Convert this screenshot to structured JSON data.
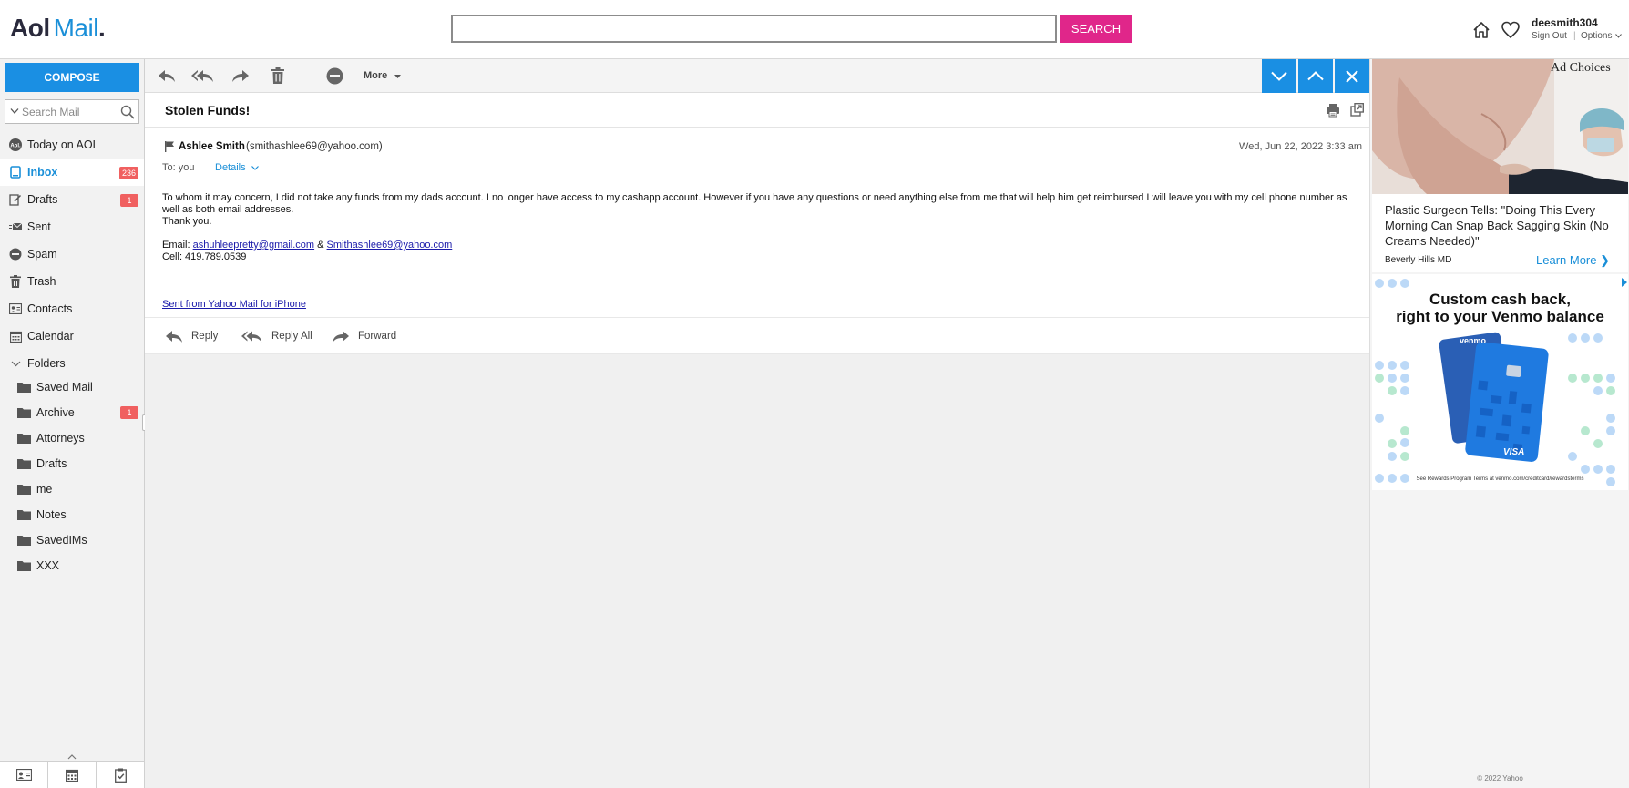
{
  "header": {
    "logo_aol": "Aol",
    "logo_mail": "Mail",
    "logo_dot": ".",
    "search_value": "",
    "search_button": "SEARCH",
    "username": "deesmith304",
    "sign_out": "Sign Out",
    "separator": "|",
    "options": "Options"
  },
  "sidebar": {
    "compose": "COMPOSE",
    "search_placeholder": "Search Mail",
    "nav": [
      {
        "label": "Today on AOL",
        "icon": "aol-icon"
      },
      {
        "label": "Inbox",
        "icon": "inbox-icon",
        "badge": "236",
        "active": true
      },
      {
        "label": "Drafts",
        "icon": "drafts-icon",
        "badge": "1"
      },
      {
        "label": "Sent",
        "icon": "sent-icon"
      },
      {
        "label": "Spam",
        "icon": "spam-icon"
      },
      {
        "label": "Trash",
        "icon": "trash-icon"
      },
      {
        "label": "Contacts",
        "icon": "contacts-icon"
      },
      {
        "label": "Calendar",
        "icon": "calendar-icon"
      },
      {
        "label": "Folders",
        "icon": "chevron-down-icon"
      }
    ],
    "folders": [
      {
        "label": "Saved Mail"
      },
      {
        "label": "Archive",
        "badge": "1"
      },
      {
        "label": "Attorneys"
      },
      {
        "label": "Drafts"
      },
      {
        "label": "me"
      },
      {
        "label": "Notes"
      },
      {
        "label": "SavedIMs"
      },
      {
        "label": "XXX"
      }
    ],
    "aol_icon_text": "Aol."
  },
  "toolbar": {
    "more": "More"
  },
  "message": {
    "subject": "Stolen Funds!",
    "sender_name": "Ashlee Smith",
    "sender_email": "(smithashlee69@yahoo.com)",
    "date": "Wed, Jun 22, 2022 3:33 am",
    "to": "To: you",
    "details": "Details",
    "body": "To whom it may concern, I did not take any funds from my dads account. I no longer have access to my cashapp account. However if you have any questions or need anything else from me that will help him get reimbursed I will leave you with my cell phone number as well as both email addresses.",
    "thanks": "Thank you.",
    "email_label": "Email: ",
    "email1": "ashuhleepretty@gmail.com",
    "email_amp": " & ",
    "email2": "Smithashlee69@yahoo.com",
    "cell": "Cell: 419.789.0539",
    "signature": "Sent from Yahoo Mail for iPhone"
  },
  "reply_bar": {
    "reply": "Reply",
    "reply_all": "Reply All",
    "forward": "Forward"
  },
  "ads": {
    "ad_choices": "Ad Choices",
    "ad1_title": "Plastic Surgeon Tells: \"Doing This Every Morning Can Snap Back Sagging Skin (No Creams Needed)\"",
    "ad1_sponsor": "Beverly Hills MD",
    "ad1_learn_more": "Learn More ❯",
    "ad2_line1": "Custom cash back,",
    "ad2_line2": "right to your Venmo balance",
    "ad2_venmo": "venmo",
    "ad2_visa": "VISA",
    "ad2_fine": "See Rewards Program Terms at venmo.com/creditcard/rewardsterms",
    "copyright": "© 2022 Yahoo"
  },
  "colors": {
    "accent_blue": "#1a8fe3",
    "search_pink": "#e0268a",
    "badge_red": "#f06060"
  }
}
